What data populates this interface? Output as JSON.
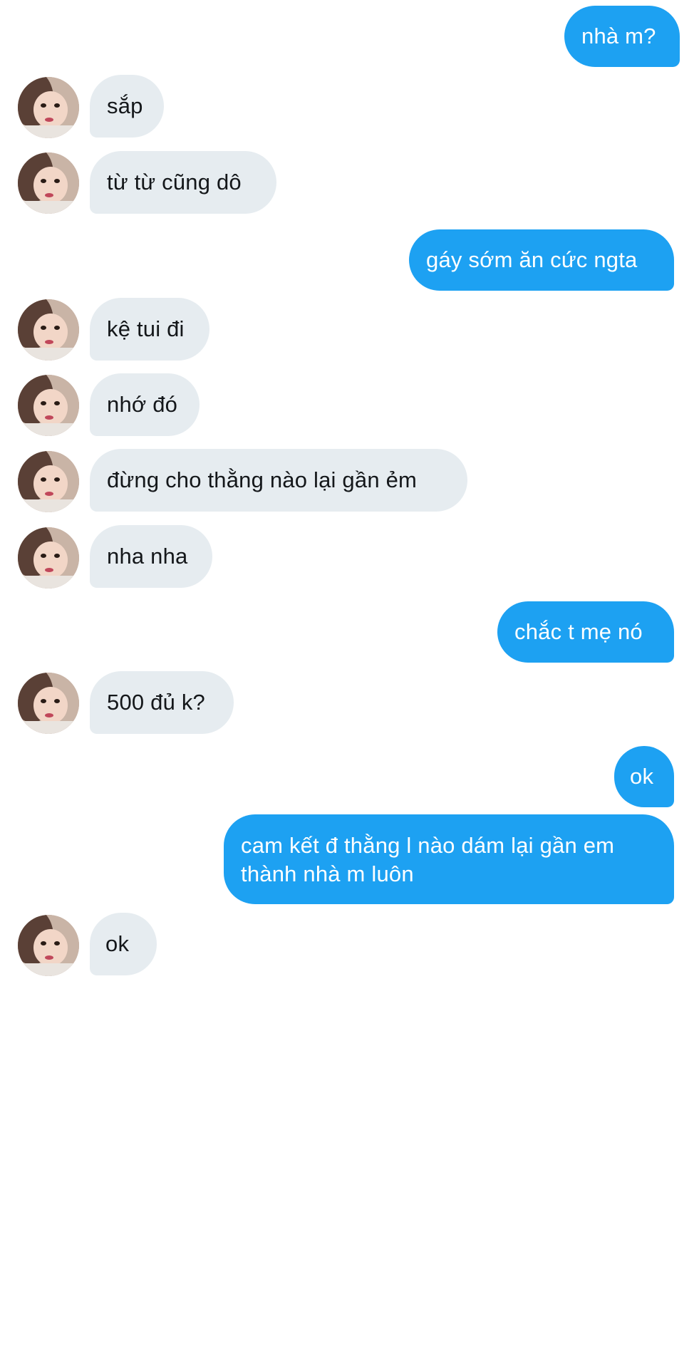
{
  "messages": [
    {
      "side": "out",
      "text": "nhà m?"
    },
    {
      "side": "in",
      "text": "sắp"
    },
    {
      "side": "in",
      "text": "từ từ cũng dô"
    },
    {
      "side": "out",
      "text": "gáy sớm ăn cức ngta"
    },
    {
      "side": "in",
      "text": "kệ tui đi"
    },
    {
      "side": "in",
      "text": "nhớ đó"
    },
    {
      "side": "in",
      "text": "đừng cho thằng nào lại gần ẻm"
    },
    {
      "side": "in",
      "text": "nha nha"
    },
    {
      "side": "out",
      "text": "chắc t mẹ nó"
    },
    {
      "side": "in",
      "text": "500 đủ k?"
    },
    {
      "side": "out",
      "text": "ok"
    },
    {
      "side": "out",
      "text": "cam kết đ thằng l nào dám lại gần em thành nhà m luôn"
    },
    {
      "side": "in",
      "text": "ok"
    }
  ],
  "colors": {
    "outgoing_bubble": "#1da1f2",
    "outgoing_text": "#ffffff",
    "incoming_bubble": "#e6ecf0",
    "incoming_text": "#14171a"
  },
  "icons": {
    "avatar": "contact-avatar-photo"
  }
}
